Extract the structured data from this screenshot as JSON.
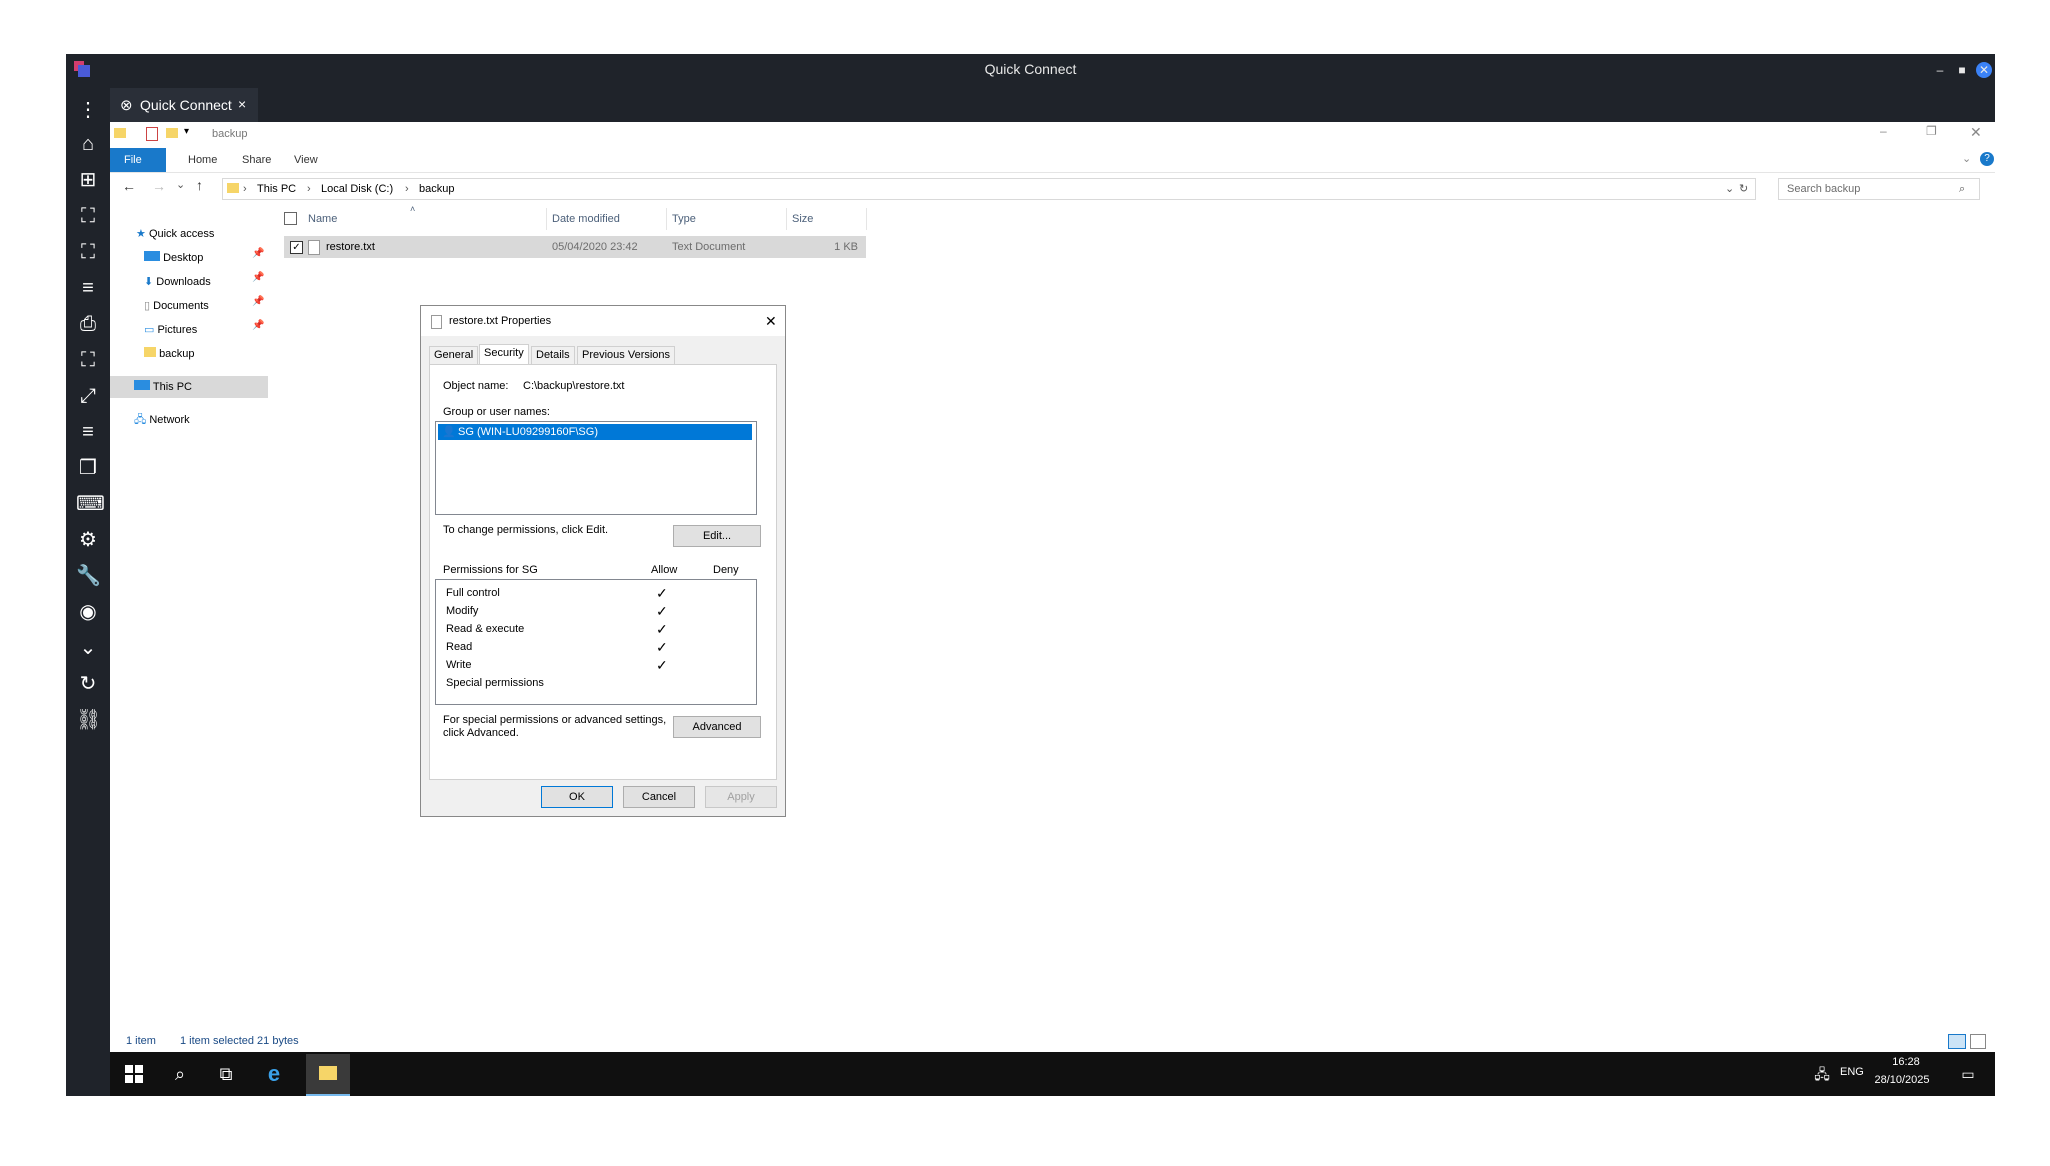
{
  "window": {
    "title": "Quick Connect"
  },
  "tab": {
    "label": "Quick Connect",
    "close": "×"
  },
  "sidebar_icons": [
    "menu-dots-icon",
    "home-icon",
    "add-window-icon",
    "fit-icon",
    "fullscreen-icon",
    "list-icon",
    "print-icon",
    "fit-alt-icon",
    "expand-icon",
    "lines-icon",
    "window-icon",
    "keyboard-icon",
    "settings-icon",
    "wrench-icon",
    "camera-icon",
    "chevron-down-icon",
    "refresh-icon",
    "unlink-icon"
  ],
  "explorer": {
    "qat_title": "backup",
    "ribbon_tabs": [
      "File",
      "Home",
      "Share",
      "View"
    ],
    "address": {
      "segments": [
        "This PC",
        "Local Disk (C:)",
        "backup"
      ]
    },
    "search_placeholder": "Search backup",
    "nav": {
      "quick_access": "Quick access",
      "desktop": "Desktop",
      "downloads": "Downloads",
      "documents": "Documents",
      "pictures": "Pictures",
      "backup": "backup",
      "this_pc": "This PC",
      "network": "Network"
    },
    "columns": {
      "name": "Name",
      "date": "Date modified",
      "type": "Type",
      "size": "Size"
    },
    "row": {
      "name": "restore.txt",
      "date": "05/04/2020 23:42",
      "type": "Text Document",
      "size": "1 KB"
    },
    "status": {
      "count": "1 item",
      "selected": "1 item selected  21 bytes"
    }
  },
  "dialog": {
    "title": "restore.txt Properties",
    "tabs": [
      "General",
      "Security",
      "Details",
      "Previous Versions"
    ],
    "object_name_label": "Object name:",
    "object_name_value": "C:\\backup\\restore.txt",
    "group_label": "Group or user names:",
    "user": "SG (WIN-LU09299160F\\SG)",
    "change_text": "To change permissions, click Edit.",
    "edit_button": "Edit...",
    "perm_label": "Permissions for SG",
    "allow": "Allow",
    "deny": "Deny",
    "permissions": [
      {
        "name": "Full control",
        "allow": "✓"
      },
      {
        "name": "Modify",
        "allow": "✓"
      },
      {
        "name": "Read & execute",
        "allow": "✓"
      },
      {
        "name": "Read",
        "allow": "✓"
      },
      {
        "name": "Write",
        "allow": "✓"
      },
      {
        "name": "Special permissions",
        "allow": ""
      }
    ],
    "special_text_1": "For special permissions or advanced settings,",
    "special_text_2": "click Advanced.",
    "advanced_button": "Advanced",
    "ok": "OK",
    "cancel": "Cancel",
    "apply": "Apply"
  },
  "taskbar": {
    "lang": "ENG",
    "time": "16:28",
    "date": "28/10/2025"
  }
}
